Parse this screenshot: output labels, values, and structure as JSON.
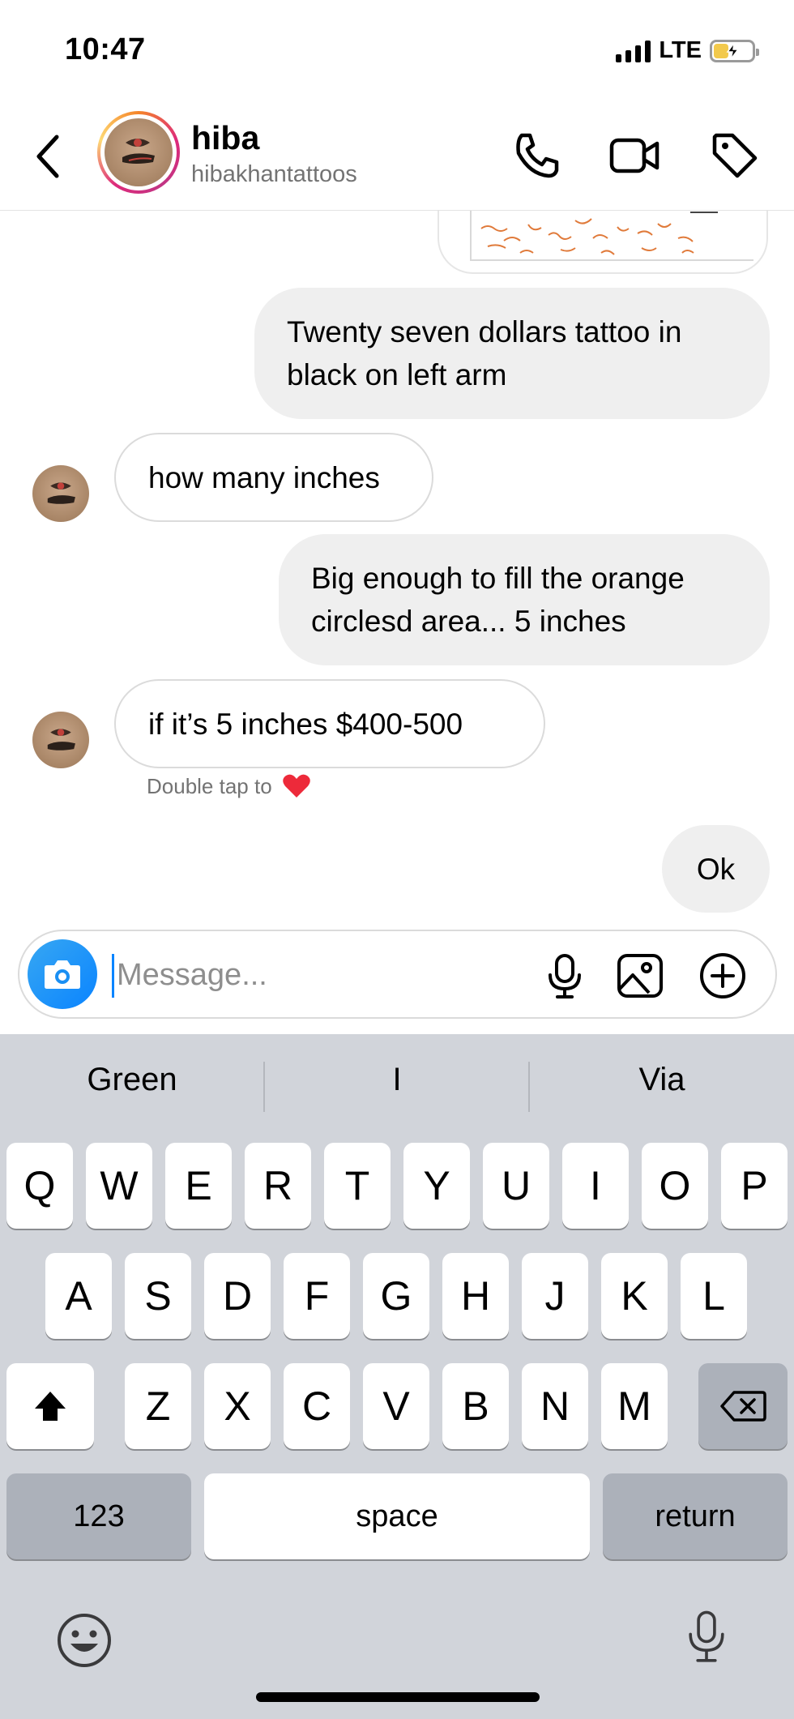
{
  "status_bar": {
    "time": "10:47",
    "network": "LTE"
  },
  "header": {
    "contact_name": "hiba",
    "contact_username": "hibakhantattoos"
  },
  "messages": [
    {
      "direction": "outgoing",
      "text": "Twenty seven dollars tattoo in black on left arm"
    },
    {
      "direction": "incoming",
      "text": "how many inches"
    },
    {
      "direction": "outgoing",
      "text": "Big enough to fill the orange circlesd area... 5 inches"
    },
    {
      "direction": "incoming",
      "text": "if it’s 5 inches $400-500"
    },
    {
      "direction": "outgoing",
      "text": "Ok"
    }
  ],
  "double_tap_hint": "Double tap to",
  "composer": {
    "placeholder": "Message..."
  },
  "keyboard": {
    "suggestions": [
      "Green",
      "I",
      "Via"
    ],
    "row1": [
      "Q",
      "W",
      "E",
      "R",
      "T",
      "Y",
      "U",
      "I",
      "O",
      "P"
    ],
    "row2": [
      "A",
      "S",
      "D",
      "F",
      "G",
      "H",
      "J",
      "K",
      "L"
    ],
    "row3": [
      "Z",
      "X",
      "C",
      "V",
      "B",
      "N",
      "M"
    ],
    "numbers_key": "123",
    "space_key": "space",
    "return_key": "return"
  },
  "colors": {
    "accent_blue": "#0a84ff",
    "heart_red": "#ed2a3a",
    "battery_yellow": "#f2c94c"
  }
}
